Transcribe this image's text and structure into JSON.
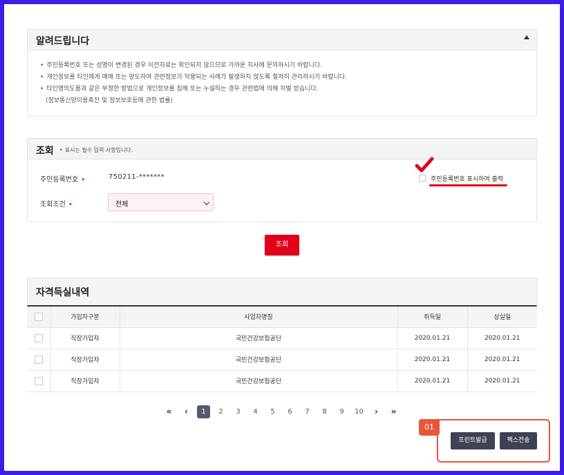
{
  "notice": {
    "title": "알려드립니다",
    "items": [
      "주민등록번호 또는 성명이 변경된 경우 이전자료는 확인되지 않으므로 가까운 지사에 문의하시기 바랍니다.",
      "개인정보를 타인에게 매매 또는 양도하여 관련정보가 악용되는 사례가 발생하지 않도록 철저히 관리하시기 바랍니다.",
      "타인명의도용과 같은 부정한 방법으로 개인정보를 침해 또는 누설하는 경우 관련법에 의해 처벌 받습니다."
    ],
    "items_sub": "(정보통신망이용촉진 및 정보보호등에 관한 법률)"
  },
  "search": {
    "title": "조회",
    "required_note": "표시는 필수 입력 사항입니다.",
    "rrn_label": "주민등록번호",
    "rrn_value": "750211-*******",
    "condition_label": "조회조건",
    "condition_value": "전체",
    "print_rrn_label": "주민등록번호 표시하여 출력",
    "submit_label": "조회"
  },
  "history": {
    "title": "자격득실내역",
    "columns": [
      "가입자구분",
      "사업자명칭",
      "취득일",
      "상실일"
    ],
    "rows": [
      [
        "직장가입자",
        "국민건강보험공단",
        "2020.01.21",
        "2020.01.21"
      ],
      [
        "직장가입자",
        "국민건강보험공단",
        "2020.01.21",
        "2020.01.21"
      ],
      [
        "직장가입자",
        "국민건강보험공단",
        "2020.01.21",
        "2020.01.21"
      ]
    ]
  },
  "pagination": {
    "first": "«",
    "prev": "‹",
    "pages": [
      "1",
      "2",
      "3",
      "4",
      "5",
      "6",
      "7",
      "8",
      "9",
      "10"
    ],
    "current": "1",
    "next": "›",
    "last": "»"
  },
  "actions": {
    "step_tag": "01",
    "print_label": "프린트발급",
    "fax_label": "팩스전송"
  },
  "colors": {
    "accent_red": "#e0001b",
    "frame_blue": "#3a1ee6",
    "highlight_orange": "#e8553a",
    "button_dark": "#3e4252"
  }
}
